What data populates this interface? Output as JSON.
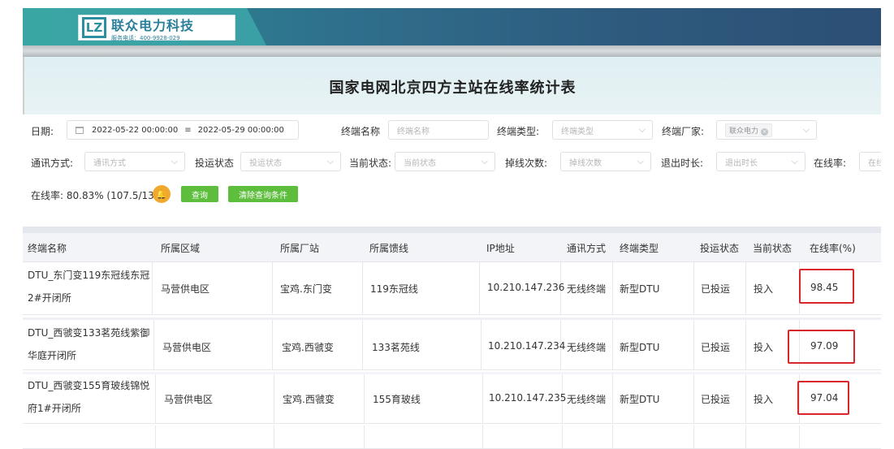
{
  "header": {
    "logo_mark": "LZ",
    "company_name": "联众电力科技",
    "service_phone": "服务电话：400-9928-029",
    "page_title": "国家电网北京四方主站在线率统计表"
  },
  "filters": {
    "date": {
      "label": "日期:",
      "start": "2022-05-22 00:00:00",
      "end": "2022-05-29 00:00:00"
    },
    "terminal_name": {
      "label": "终端名称",
      "placeholder": "终端名称"
    },
    "terminal_type": {
      "label": "终端类型:",
      "placeholder": "终端类型"
    },
    "terminal_vendor": {
      "label": "终端厂家:",
      "selected_tag": "联众电力"
    },
    "comm_mode": {
      "label": "通讯方式:",
      "placeholder": "通讯方式"
    },
    "operation_status": {
      "label": "投运状态",
      "placeholder": "投运状态"
    },
    "current_status": {
      "label": "当前状态:",
      "placeholder": "当前状态"
    },
    "disconnect_count": {
      "label": "掉线次数:",
      "placeholder": "掉线次数"
    },
    "exit_duration": {
      "label": "退出时长:",
      "placeholder": "退出时长"
    },
    "online_rate": {
      "label": "在线率:",
      "placeholder": "在线"
    }
  },
  "summary": {
    "text": "在线率: 80.83% (107.5/133)"
  },
  "buttons": {
    "query": "查询",
    "clear": "清除查询条件"
  },
  "table": {
    "columns": [
      "终端名称",
      "所属区域",
      "所属厂站",
      "所属馈线",
      "IP地址",
      "通讯方式",
      "终端类型",
      "投运状态",
      "当前状态",
      "在线率(%)"
    ],
    "rows": [
      {
        "name": "DTU_东门变119东冠线东冠2#开闭所",
        "region": "马营供电区",
        "station": "宝鸡.东门变",
        "feeder": "119东冠线",
        "ip": "10.210.147.236",
        "comm": "无线终端",
        "type": "新型DTU",
        "op": "已投运",
        "status": "投入",
        "rate": "98.45"
      },
      {
        "name": "DTU_西虢变133茗苑线紫御华庭开闭所",
        "region": "马营供电区",
        "station": "宝鸡.西虢变",
        "feeder": "133茗苑线",
        "ip": "10.210.147.234",
        "comm": "无线终端",
        "type": "新型DTU",
        "op": "已投运",
        "status": "投入",
        "rate": "97.09"
      },
      {
        "name": "DTU_西虢变155育玻线锦悦府1#开闭所",
        "region": "马营供电区",
        "station": "宝鸡.西虢变",
        "feeder": "155育玻线",
        "ip": "10.210.147.235",
        "comm": "无线终端",
        "type": "新型DTU",
        "op": "已投运",
        "status": "投入",
        "rate": "97.04"
      }
    ]
  },
  "colors": {
    "accent_green": "#5dbd3c",
    "highlight_red": "#d8272b",
    "bell_orange": "#f0a92e"
  }
}
